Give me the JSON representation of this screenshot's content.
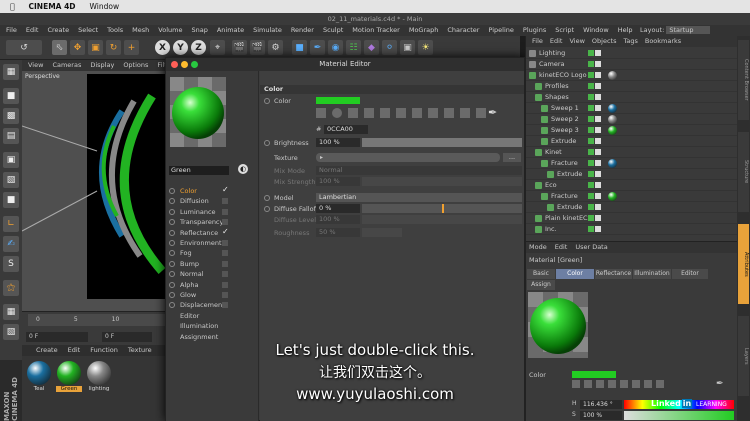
{
  "mac_menu": {
    "app": "CINEMA 4D",
    "window": "Window"
  },
  "window_title": "02_11_materials.c4d * - Main",
  "main_menu": [
    "File",
    "Edit",
    "Create",
    "Select",
    "Tools",
    "Mesh",
    "Volume",
    "Snap",
    "Animate",
    "Simulate",
    "Render",
    "Sculpt",
    "Motion Tracker",
    "MoGraph",
    "Character",
    "Pipeline",
    "Plugins",
    "Script",
    "Window",
    "Help"
  ],
  "layout": {
    "label": "Layout:",
    "value": "Startup"
  },
  "toolbar": {
    "axis_x": "X",
    "axis_y": "Y",
    "axis_z": "Z"
  },
  "viewport": {
    "menu": [
      "View",
      "Cameras",
      "Display",
      "Options",
      "Filter"
    ],
    "label": "Perspective"
  },
  "timeline": {
    "marks": [
      "0",
      "5",
      "10"
    ],
    "frame": "0 F",
    "frame2": "0 F"
  },
  "material_manager": {
    "menu": [
      "Create",
      "Edit",
      "Function",
      "Texture"
    ],
    "materials": [
      {
        "name": "Teal",
        "color": "#1a6fa0"
      },
      {
        "name": "Green",
        "color": "#22b322"
      },
      {
        "name": "lighting",
        "color": "#888888"
      }
    ],
    "maxon_logo": "MAXON CINEMA 4D"
  },
  "material_editor": {
    "title": "Material Editor",
    "material_name": "Green",
    "channels": [
      {
        "name": "Color",
        "selected": true,
        "checked": true
      },
      {
        "name": "Diffusion",
        "checked": false
      },
      {
        "name": "Luminance",
        "checked": false
      },
      {
        "name": "Transparency",
        "checked": false
      },
      {
        "name": "Reflectance",
        "checked": true
      },
      {
        "name": "Environment",
        "checked": false
      },
      {
        "name": "Fog",
        "checked": false
      },
      {
        "name": "Bump",
        "checked": false
      },
      {
        "name": "Normal",
        "checked": false
      },
      {
        "name": "Alpha",
        "checked": false
      },
      {
        "name": "Glow",
        "checked": false
      },
      {
        "name": "Displacement",
        "checked": false
      },
      {
        "name": "Editor"
      },
      {
        "name": "Illumination"
      },
      {
        "name": "Assignment"
      }
    ],
    "color_section": "Color",
    "color_label": "Color",
    "color_hex_prefix": "#",
    "color_hex": "0CCA00",
    "color_value": "#22cc22",
    "brightness_label": "Brightness",
    "brightness_value": "100 %",
    "brightness_fraction": 1.0,
    "texture_label": "Texture",
    "mix_mode_label": "Mix Mode",
    "mix_mode_value": "Normal",
    "mix_strength_label": "Mix Strength",
    "mix_strength_value": "100 %",
    "model_label": "Model",
    "model_value": "Lambertian",
    "diffuse_falloff_label": "Diffuse Falloff",
    "diffuse_falloff_value": "0 %",
    "diffuse_level_label": "Diffuse Level",
    "diffuse_level_value": "100 %",
    "roughness_label": "Roughness",
    "roughness_value": "50 %",
    "more_button": "..."
  },
  "object_manager": {
    "menu": [
      "File",
      "Edit",
      "View",
      "Objects",
      "Tags",
      "Bookmarks"
    ],
    "objects": [
      {
        "name": "Lighting",
        "indent": 0
      },
      {
        "name": "Camera",
        "indent": 0
      },
      {
        "name": "kinetECO Logo",
        "indent": 0
      },
      {
        "name": "Profiles",
        "indent": 1
      },
      {
        "name": "Shapes",
        "indent": 1
      },
      {
        "name": "Sweep 1",
        "indent": 2
      },
      {
        "name": "Sweep 2",
        "indent": 2
      },
      {
        "name": "Sweep 3",
        "indent": 2
      },
      {
        "name": "Extrude",
        "indent": 2
      },
      {
        "name": "Kinet",
        "indent": 1
      },
      {
        "name": "Fracture",
        "indent": 2
      },
      {
        "name": "Extrude",
        "indent": 3
      },
      {
        "name": "Eco",
        "indent": 1
      },
      {
        "name": "Fracture",
        "indent": 2
      },
      {
        "name": "Extrude",
        "indent": 3
      },
      {
        "name": "Plain kinetECO",
        "indent": 1
      },
      {
        "name": "Inc.",
        "indent": 1
      }
    ]
  },
  "attribute_manager": {
    "menu": [
      "Mode",
      "Edit",
      "User Data"
    ],
    "title": "Material [Green]",
    "tabs": [
      "Basic",
      "Color",
      "Reflectance",
      "Illumination",
      "Editor",
      "Assign"
    ],
    "selected_tab": "Color",
    "color_label": "Color",
    "h_label": "H",
    "h_value": "116.436 °",
    "s_label": "S",
    "s_value": "100 %"
  },
  "right_strip": [
    "Content Browser",
    "Structure",
    "Attributes",
    "Layers"
  ],
  "subtitles": {
    "english": "Let's just double-click this.",
    "chinese": "让我们双击这个。",
    "url": "www.yuyulaoshi.com"
  },
  "watermark": {
    "linked": "Linked",
    "in": "in",
    "learning": "LEARNING"
  }
}
